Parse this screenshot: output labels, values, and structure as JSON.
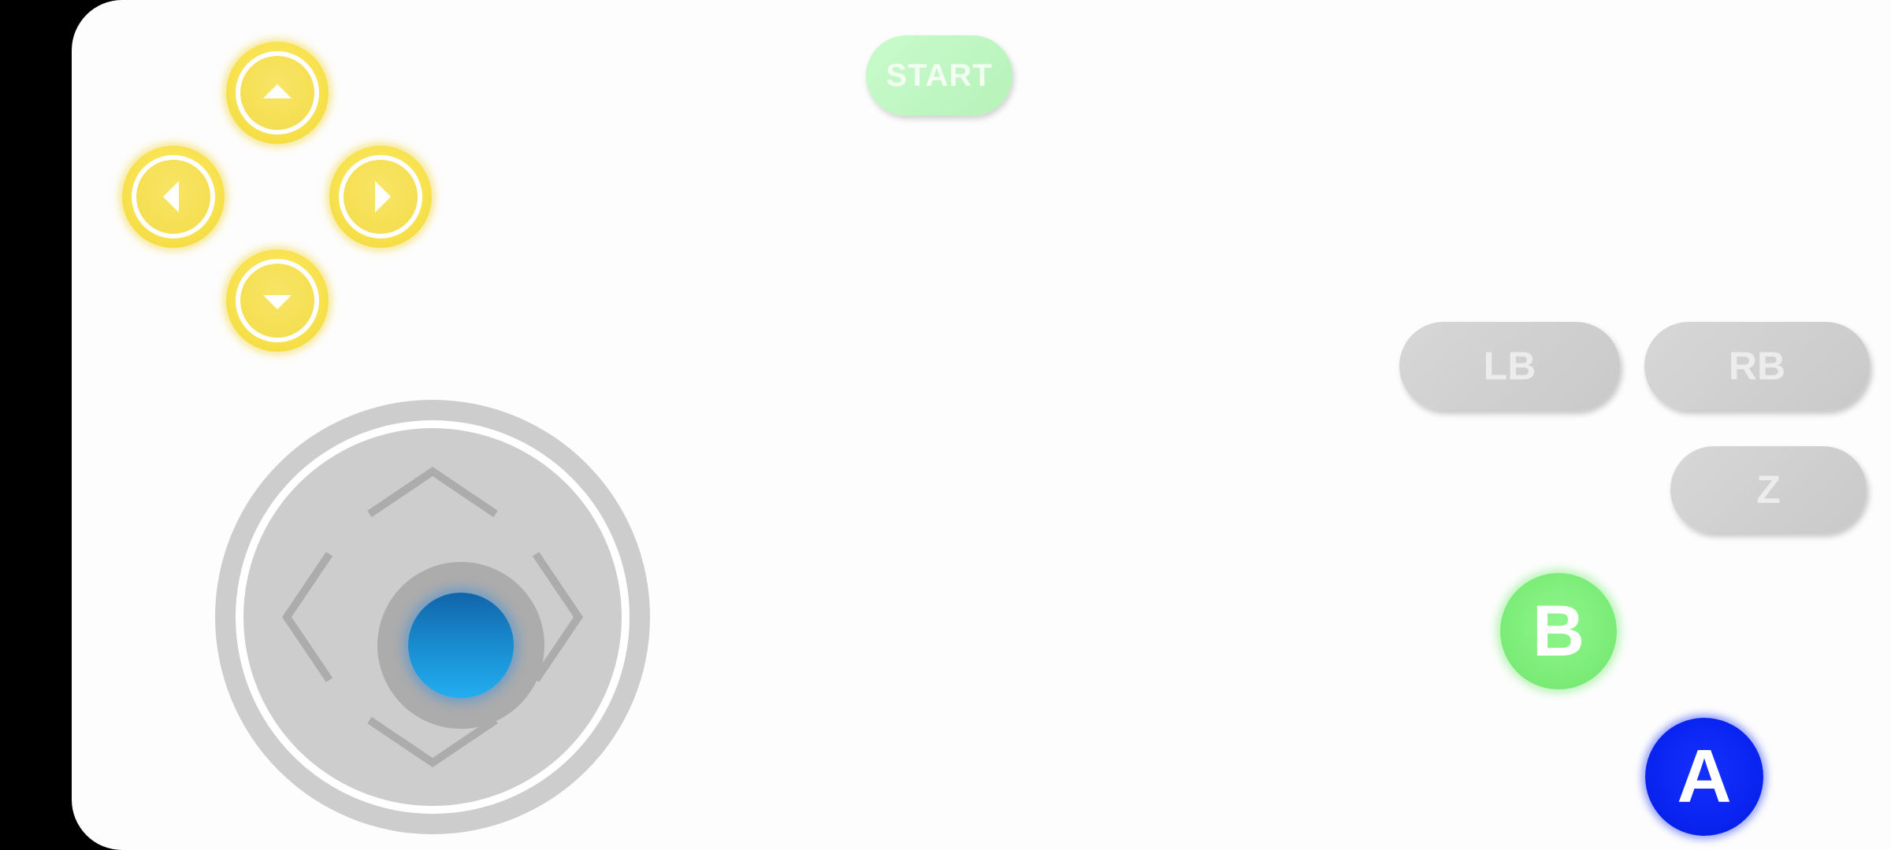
{
  "controller": {
    "start_label": "START",
    "lb_label": "LB",
    "rb_label": "RB",
    "z_label": "Z",
    "b_label": "B",
    "a_label": "A"
  },
  "icons": {
    "dpad_up": "triangle-up-icon",
    "dpad_down": "triangle-down-icon",
    "dpad_left": "triangle-left-icon",
    "dpad_right": "triangle-right-icon",
    "joystick_chevrons": "chevron-arrows-icon"
  },
  "colors": {
    "dpad": "#f7e14c",
    "start": "#c9fbcc",
    "shoulder": "#d0d0d0",
    "b_button": "#7ced78",
    "a_button": "#0a24f0",
    "joystick_knob": "#1a8fd3",
    "joystick_base": "#cdcdcd"
  }
}
